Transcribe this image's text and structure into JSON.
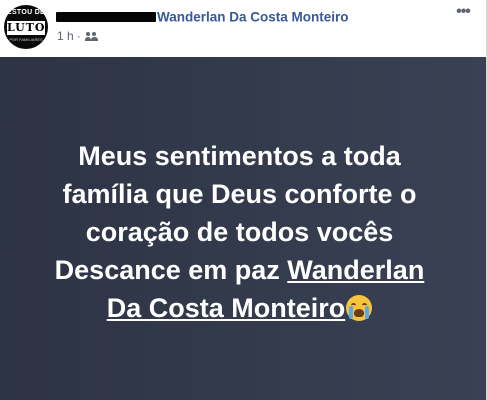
{
  "post": {
    "author": {
      "avatar_text_top": "ESTOU DE",
      "avatar_text_main": "LUTO",
      "avatar_text_bottom": "POR FAMILIARES",
      "name": "Wanderlan Da Costa Monteiro"
    },
    "time": "1 h",
    "separator": "·",
    "audience_icon": "friends-icon",
    "more_icon": "more-options-icon",
    "more_label": "•••",
    "message": {
      "line1": "Meus sentimentos a toda",
      "line2": "família que Deus conforte o",
      "line3": "coração de todos vocês",
      "line4_prefix": "Descance em paz ",
      "mention_part1": "Wanderlan",
      "mention_part2": "Da Costa Monteiro",
      "emoji": "crying-face-emoji"
    }
  },
  "colors": {
    "author_name": "#385898",
    "meta_text": "#616770",
    "card_background": "#343b4d",
    "message_text": "#ffffff"
  }
}
